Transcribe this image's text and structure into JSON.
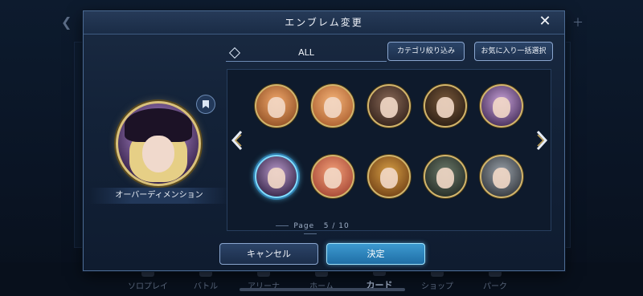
{
  "modal": {
    "title": "エンブレム変更",
    "close_icon": "close-icon"
  },
  "preview": {
    "name": "オーバーディメンション"
  },
  "filter": {
    "label": "ALL",
    "category_button": "カテゴリ絞り込み",
    "favorite_button": "お気に入り一括選択"
  },
  "grid": {
    "emblems": [
      {
        "id": "emblem-1",
        "colors": [
          "#f2a86b",
          "#8a4a20"
        ],
        "selected": false
      },
      {
        "id": "emblem-2",
        "colors": [
          "#f5b57a",
          "#a85a2a"
        ],
        "selected": false
      },
      {
        "id": "emblem-3",
        "colors": [
          "#8a6a58",
          "#2d1c16"
        ],
        "selected": false
      },
      {
        "id": "emblem-4",
        "colors": [
          "#7a5a3c",
          "#241810"
        ],
        "selected": false
      },
      {
        "id": "emblem-5",
        "colors": [
          "#c9a2d8",
          "#3a2450"
        ],
        "selected": false
      },
      {
        "id": "emblem-6",
        "colors": [
          "#b99acb",
          "#2a1a3c"
        ],
        "selected": true
      },
      {
        "id": "emblem-7",
        "colors": [
          "#f4a27a",
          "#a04030"
        ],
        "selected": false
      },
      {
        "id": "emblem-8",
        "colors": [
          "#d8a046",
          "#6a3a12"
        ],
        "selected": false
      },
      {
        "id": "emblem-9",
        "colors": [
          "#6c7a6a",
          "#1e2520"
        ],
        "selected": false
      },
      {
        "id": "emblem-10",
        "colors": [
          "#9aa2aa",
          "#2c3036"
        ],
        "selected": false
      }
    ],
    "prev_icon": "chevron-left-icon",
    "next_icon": "chevron-right-icon"
  },
  "pager": {
    "label": "Page",
    "current": "5",
    "separator": "/",
    "total": "10"
  },
  "actions": {
    "cancel": "キャンセル",
    "confirm": "決定"
  },
  "background_nav": {
    "items": [
      "ソロプレイ",
      "バトル",
      "アリーナ",
      "ホーム",
      "カード",
      "ショップ",
      "パーク"
    ],
    "active": "カード"
  },
  "colors": {
    "accent": "#5fd0ff",
    "gold": "#d2b56c",
    "modal_bg": "#132238"
  }
}
